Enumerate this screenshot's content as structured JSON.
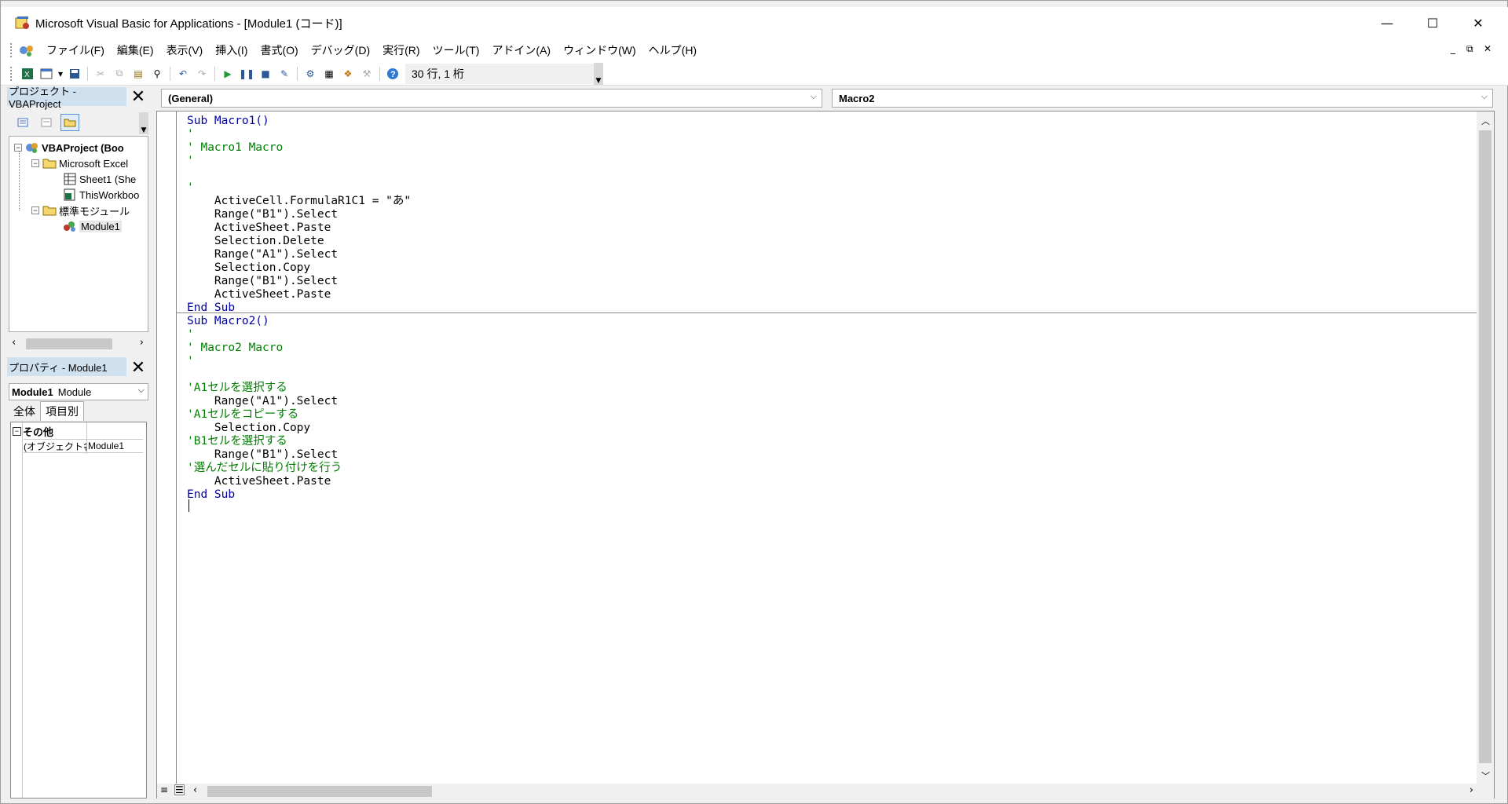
{
  "window": {
    "title": "Microsoft Visual Basic for Applications - [Module1 (コード)]",
    "minimize": "—",
    "maximize": "☐",
    "close": "✕"
  },
  "menubar": {
    "items": [
      "ファイル(F)",
      "編集(E)",
      "表示(V)",
      "挿入(I)",
      "書式(O)",
      "デバッグ(D)",
      "実行(R)",
      "ツール(T)",
      "アドイン(A)",
      "ウィンドウ(W)",
      "ヘルプ(H)"
    ],
    "mdi_min": "_",
    "mdi_restore": "⧉",
    "mdi_close": "✕"
  },
  "toolbar": {
    "position_label": "30 行, 1 桁"
  },
  "project_panel": {
    "title": "プロジェクト - VBAProject",
    "tree": [
      {
        "label": "VBAProject (Boo",
        "level": 0,
        "expander": "−",
        "icon": "vbaproject-icon"
      },
      {
        "label": "Microsoft Excel",
        "level": 1,
        "expander": "−",
        "icon": "folder-icon"
      },
      {
        "label": "Sheet1 (She",
        "level": 2,
        "expander": "",
        "icon": "sheet-icon"
      },
      {
        "label": "ThisWorkboo",
        "level": 2,
        "expander": "",
        "icon": "workbook-icon"
      },
      {
        "label": "標準モジュール",
        "level": 1,
        "expander": "−",
        "icon": "folder-icon"
      },
      {
        "label": "Module1",
        "level": 2,
        "expander": "",
        "icon": "module-icon"
      }
    ]
  },
  "properties_panel": {
    "title": "プロパティ - Module1",
    "object_name": "Module1",
    "object_type": "Module",
    "tabs": [
      "全体",
      "項目別"
    ],
    "category": "その他",
    "property_name": "(オブジェクト名)",
    "property_value": "Module1"
  },
  "code_window": {
    "object_combo": "(General)",
    "procedure_combo": "Macro2",
    "lines": [
      {
        "text": "Sub Macro1()",
        "type": "kw"
      },
      {
        "text": "'",
        "type": "cm"
      },
      {
        "text": "' Macro1 Macro",
        "type": "cm"
      },
      {
        "text": "'",
        "type": "cm"
      },
      {
        "text": "",
        "type": "plain"
      },
      {
        "text": "'",
        "type": "cm"
      },
      {
        "text": "    ActiveCell.FormulaR1C1 = \"あ\"",
        "type": "plain"
      },
      {
        "text": "    Range(\"B1\").Select",
        "type": "plain"
      },
      {
        "text": "    ActiveSheet.Paste",
        "type": "plain"
      },
      {
        "text": "    Selection.Delete",
        "type": "plain"
      },
      {
        "text": "    Range(\"A1\").Select",
        "type": "plain"
      },
      {
        "text": "    Selection.Copy",
        "type": "plain"
      },
      {
        "text": "    Range(\"B1\").Select",
        "type": "plain"
      },
      {
        "text": "    ActiveSheet.Paste",
        "type": "plain"
      },
      {
        "text": "End Sub",
        "type": "kw"
      },
      {
        "text": "Sub Macro2()",
        "type": "kw"
      },
      {
        "text": "'",
        "type": "cm"
      },
      {
        "text": "' Macro2 Macro",
        "type": "cm"
      },
      {
        "text": "'",
        "type": "cm"
      },
      {
        "text": "",
        "type": "plain"
      },
      {
        "text": "'A1セルを選択する",
        "type": "cm"
      },
      {
        "text": "    Range(\"A1\").Select",
        "type": "plain"
      },
      {
        "text": "'A1セルをコピーする",
        "type": "cm"
      },
      {
        "text": "    Selection.Copy",
        "type": "plain"
      },
      {
        "text": "'B1セルを選択する",
        "type": "cm"
      },
      {
        "text": "    Range(\"B1\").Select",
        "type": "plain"
      },
      {
        "text": "'選んだセルに貼り付けを行う",
        "type": "cm"
      },
      {
        "text": "    ActiveSheet.Paste",
        "type": "plain"
      },
      {
        "text": "End Sub",
        "type": "kw"
      }
    ]
  },
  "colors": {
    "keyword": "#0000a0",
    "comment": "#008000",
    "panel_header": "#cfe0ee"
  }
}
